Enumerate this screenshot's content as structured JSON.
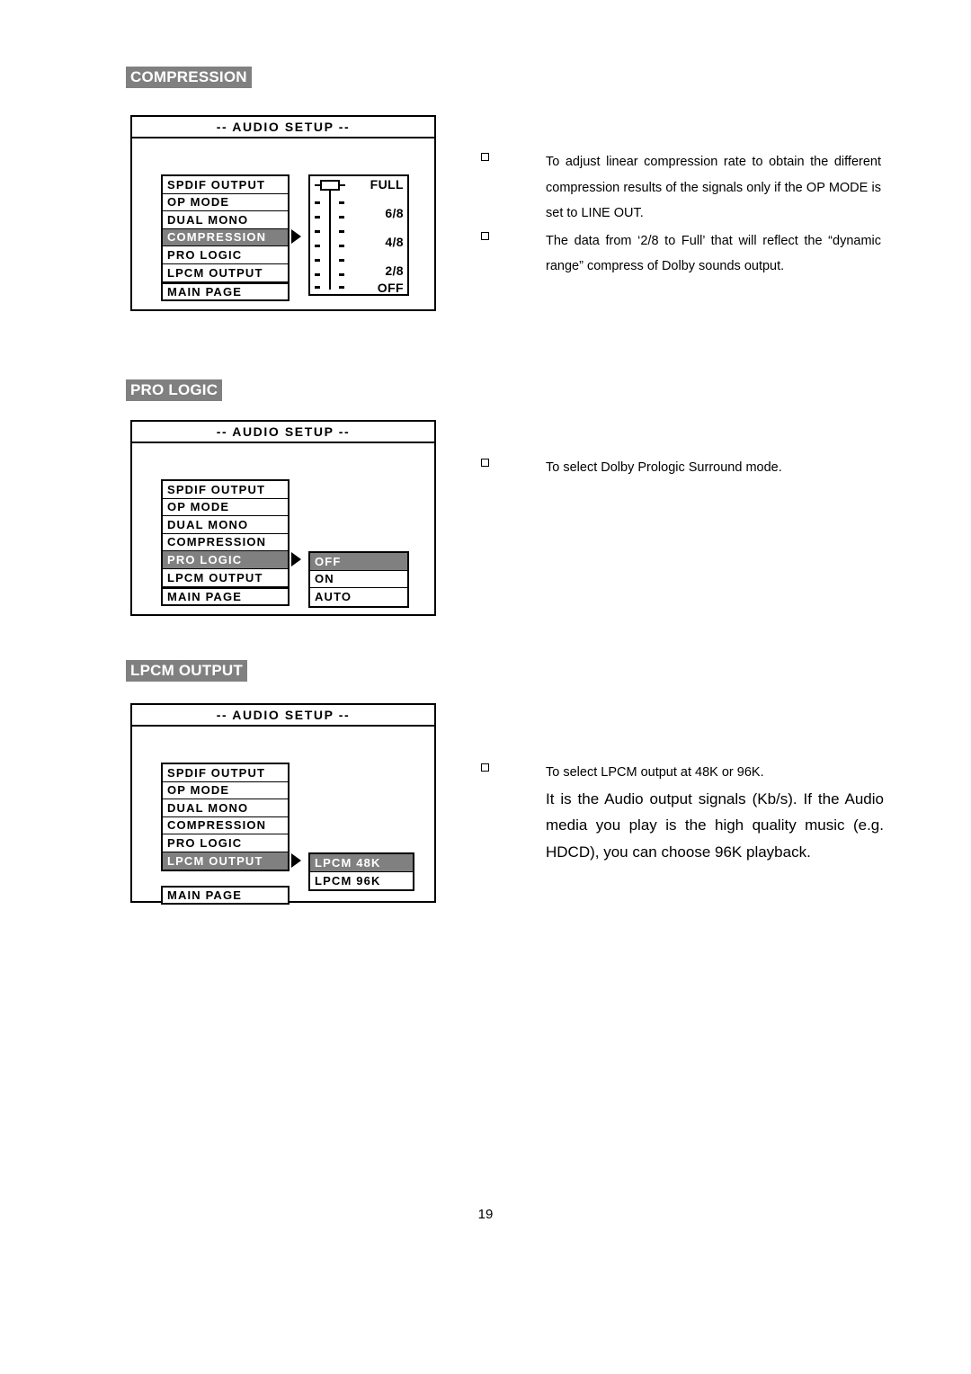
{
  "page": {
    "number": "19"
  },
  "osd_common": {
    "title": "-- AUDIO SETUP --",
    "menu_items": [
      "SPDIF OUTPUT",
      "OP MODE",
      "DUAL MONO",
      "COMPRESSION",
      "PRO LOGIC",
      "LPCM OUTPUT"
    ],
    "main_page_label": "MAIN PAGE"
  },
  "sections": [
    {
      "heading": "COMPRESSION",
      "selected_menu_index": 3,
      "slider": {
        "labels": [
          "FULL",
          "6/8",
          "4/8",
          "2/8",
          "OFF"
        ],
        "handle_position": "FULL"
      },
      "notes": [
        "To adjust linear compression rate to obtain the different compression results of the signals only if the OP MODE is set to LINE OUT.",
        "The data from ‘2/8 to Full’ that will reflect the “dynamic range” compress of Dolby sounds output."
      ]
    },
    {
      "heading": "PRO LOGIC",
      "selected_menu_index": 4,
      "options": [
        "OFF",
        "ON",
        "AUTO"
      ],
      "selected_option_index": 0,
      "notes": [
        "To select Dolby Prologic Surround mode."
      ]
    },
    {
      "heading": "LPCM OUTPUT",
      "selected_menu_index": 5,
      "options": [
        "LPCM   48K",
        "LPCM   96K"
      ],
      "selected_option_index": 0,
      "notes": [
        "To select LPCM output at 48K or 96K."
      ],
      "notes_large": [
        "It is the Audio output signals (Kb/s). If the Audio media you play is the high quality music (e.g. HDCD), you can choose 96K playback."
      ]
    }
  ]
}
